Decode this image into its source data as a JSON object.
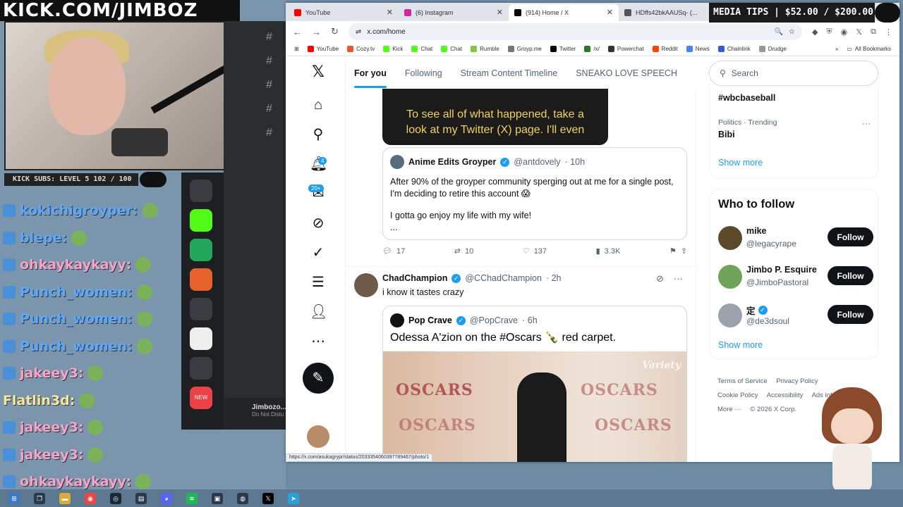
{
  "stream": {
    "banner": "KICK.COM/JIMBOZ",
    "subs_bar": "KICK SUBS: LEVEL 5 102 / 100",
    "media_tips": "MEDIA TIPS | $52.00 / $200.00",
    "chat": [
      {
        "user": "kokichigroyper:",
        "style": "blue"
      },
      {
        "user": "blepe:",
        "style": "blue"
      },
      {
        "user": "ohkaykaykayy:",
        "style": "pink"
      },
      {
        "user": "Punch_women:",
        "style": "blue"
      },
      {
        "user": "Punch_women:",
        "style": "blue"
      },
      {
        "user": "Punch_women:",
        "style": "blue"
      },
      {
        "user": "jakeey3:",
        "style": "pink"
      },
      {
        "user": "Flatlin3d:",
        "style": "yellow"
      },
      {
        "user": "jakeey3:",
        "style": "pink"
      },
      {
        "user": "jakeey3:",
        "style": "pink"
      },
      {
        "user": "ohkaykaykayy:",
        "style": "pink"
      }
    ]
  },
  "discord": {
    "new_badge": "NEW",
    "user_name": "Jimbozo...",
    "user_status": "Do Not Distu"
  },
  "browser": {
    "tabs": [
      {
        "label": "YouTube",
        "color": "#ff0000"
      },
      {
        "label": "(6) Instagram",
        "color": "#d6249f"
      },
      {
        "label": "(914) Home / X",
        "color": "#000000"
      },
      {
        "label": "HDffs42bkAAUSq- (...",
        "color": "#555555"
      }
    ],
    "url": "x.com/home",
    "bookmarks": [
      {
        "label": "YouTube",
        "color": "#ff0000"
      },
      {
        "label": "Cozy.tv",
        "color": "#e05a2b"
      },
      {
        "label": "Kick",
        "color": "#53fc18"
      },
      {
        "label": "Chat",
        "color": "#53fc18"
      },
      {
        "label": "Chat",
        "color": "#53fc18"
      },
      {
        "label": "Rumble",
        "color": "#85c742"
      },
      {
        "label": "Groyp.me",
        "color": "#777777"
      },
      {
        "label": "Twitter",
        "color": "#000000"
      },
      {
        "label": "/x/",
        "color": "#2a7a2a"
      },
      {
        "label": "Powerchat",
        "color": "#333333"
      },
      {
        "label": "Reddit",
        "color": "#ff4500"
      },
      {
        "label": "News",
        "color": "#4285f4"
      },
      {
        "label": "Chainlink",
        "color": "#375bd2"
      },
      {
        "label": "Drudge",
        "color": "#999999"
      }
    ],
    "all_bookmarks": "All Bookmarks",
    "status_url": "https://x.com/asukagrypr/status/2033354060397789467/photo/1"
  },
  "x": {
    "nav_badges": {
      "notifications": "4",
      "messages": "20+"
    },
    "tabs": [
      "For you",
      "Following",
      "Stream Content Timeline",
      "SNEAKO LOVE SPEECH"
    ],
    "media_caption_1": "To see all of what happened, take a",
    "media_caption_2": "look at my Twitter (X) page. I'll even",
    "quote1": {
      "name": "Anime Edits Groyper",
      "handle": "@antdovely",
      "time": "· 10h",
      "line1": "After 90% of the groyper community sperging out at me for a single post, I'm deciding to retire this account 😱",
      "line2": "I gotta go enjoy my life with my wife!",
      "line3": "..."
    },
    "actions": {
      "replies": "17",
      "reposts": "10",
      "likes": "137",
      "views": "3.3K"
    },
    "tweet2": {
      "name": "ChadChampion",
      "handle": "@CChadChampion",
      "time": "· 2h",
      "text": "i know it tastes crazy"
    },
    "quote2": {
      "name": "Pop Crave",
      "handle": "@PopCrave",
      "time": "· 6h",
      "text": "Odessa A'zion on the #Oscars 🍾 red carpet.",
      "image_word": "OSCARS",
      "image_brand": "Variety"
    },
    "search_placeholder": "Search",
    "trends": {
      "item1": "#wbcbaseball",
      "item2_meta": "Politics · Trending",
      "item2": "Bibi",
      "show_more": "Show more"
    },
    "who_to_follow": {
      "title": "Who to follow",
      "users": [
        {
          "name": "mike",
          "handle": "@legacyrape",
          "color": "#5a4a2a"
        },
        {
          "name": "Jimbo P. Esquire",
          "handle": "@JimboPastoral",
          "color": "#6fa45a"
        },
        {
          "name": "定",
          "handle": "@de3dsoul",
          "color": "#9aa3ab"
        }
      ],
      "follow_label": "Follow",
      "show_more": "Show more"
    },
    "footer": [
      "Terms of Service",
      "Privacy Policy",
      "Cookie Policy",
      "Accessibility",
      "Ads info",
      "More ···",
      "© 2026 X Corp."
    ]
  }
}
